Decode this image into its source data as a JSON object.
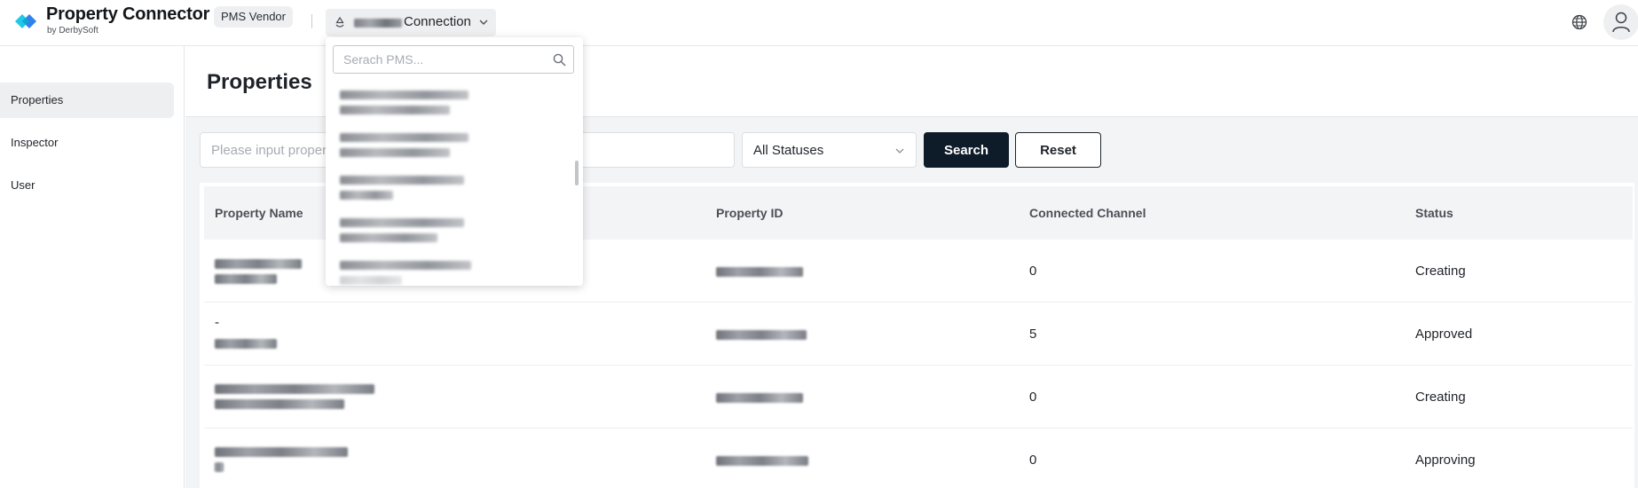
{
  "header": {
    "brand_title": "Property Connector",
    "brand_sub": "by DerbySoft",
    "role_badge": "PMS Vendor",
    "connection_label": "Connection"
  },
  "sidebar": {
    "items": [
      {
        "label": "Properties",
        "active": true
      },
      {
        "label": "Inspector",
        "active": false
      },
      {
        "label": "User",
        "active": false
      }
    ]
  },
  "main": {
    "page_title": "Properties",
    "filter": {
      "input_placeholder": "Please input proper",
      "status_value": "All Statuses",
      "search_label": "Search",
      "reset_label": "Reset"
    },
    "table": {
      "columns": [
        "Property Name",
        "Property ID",
        "Connected Channel",
        "Status"
      ],
      "rows": [
        {
          "name_line1": "",
          "connected_channel": "0",
          "status": "Creating"
        },
        {
          "name_line1": "-",
          "connected_channel": "5",
          "status": "Approved"
        },
        {
          "name_line1": "",
          "connected_channel": "0",
          "status": "Creating"
        },
        {
          "name_line1": "",
          "connected_channel": "0",
          "status": "Approving"
        }
      ]
    }
  },
  "pms_dropdown": {
    "search_placeholder": "Serach PMS..."
  },
  "colors": {
    "accent_cyan": "#1fc8e3",
    "accent_blue": "#1a73e8",
    "primary_button": "#0e1b28"
  },
  "icons": {
    "connection": "refresh-icon",
    "language": "globe-icon",
    "user": "user-icon",
    "dropdown_search": "search-icon"
  }
}
